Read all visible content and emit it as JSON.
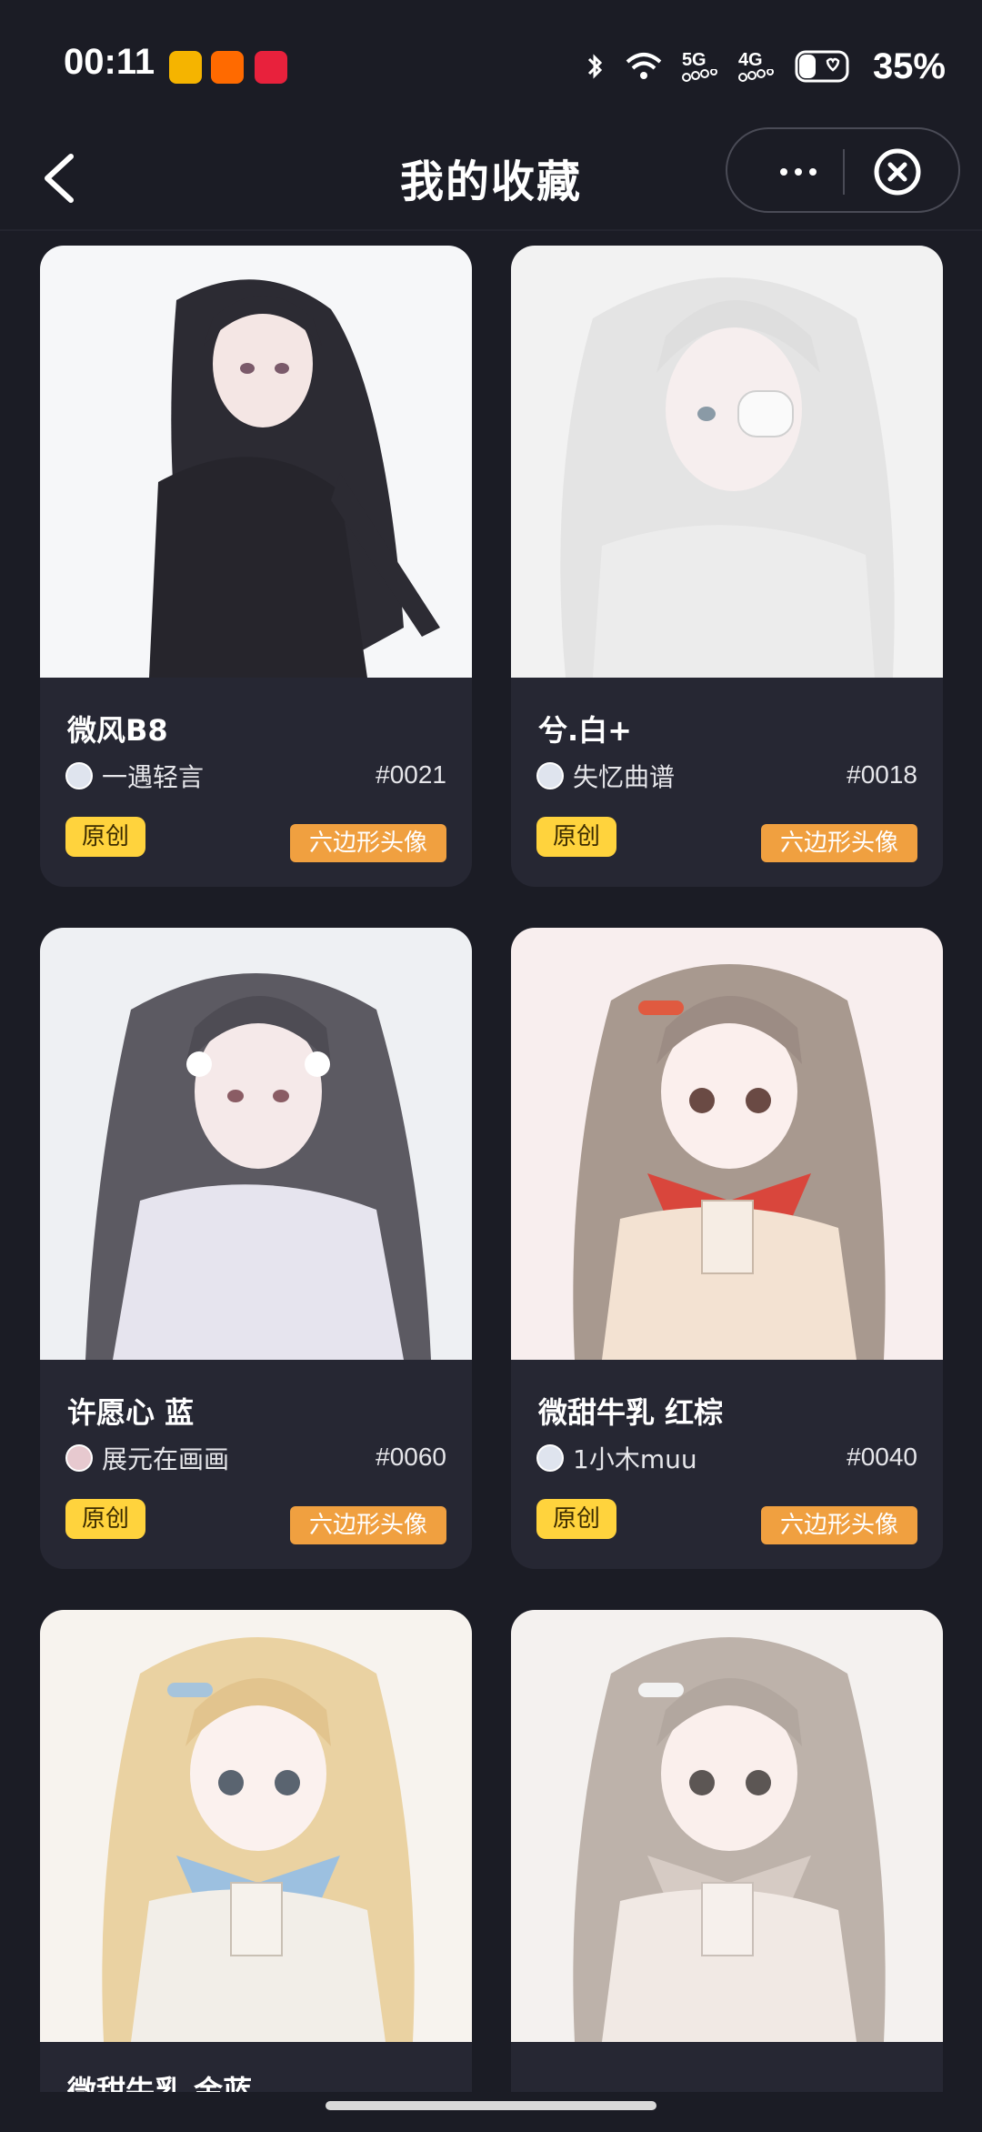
{
  "status": {
    "time": "00:11",
    "net_5g": "5G",
    "net_4g": "4G",
    "battery": "35%"
  },
  "header": {
    "title": "我的收藏"
  },
  "cards": [
    {
      "title": "微风B8",
      "author": "一遇轻言",
      "number": "#0021",
      "tag_original": "原创",
      "tag_type": "六边形头像"
    },
    {
      "title": "兮.白+",
      "author": "失忆曲谱",
      "number": "#0018",
      "tag_original": "原创",
      "tag_type": "六边形头像"
    },
    {
      "title": "许愿心 蓝",
      "author": "展元在画画",
      "number": "#0060",
      "tag_original": "原创",
      "tag_type": "六边形头像"
    },
    {
      "title": "微甜牛乳 红棕",
      "author": "1小木muu",
      "number": "#0040",
      "tag_original": "原创",
      "tag_type": "六边形头像"
    },
    {
      "title": "微甜牛乳 金蓝",
      "author": "",
      "number": "",
      "tag_original": "",
      "tag_type": ""
    },
    {
      "title": "",
      "author": "",
      "number": "",
      "tag_original": "",
      "tag_type": ""
    }
  ]
}
